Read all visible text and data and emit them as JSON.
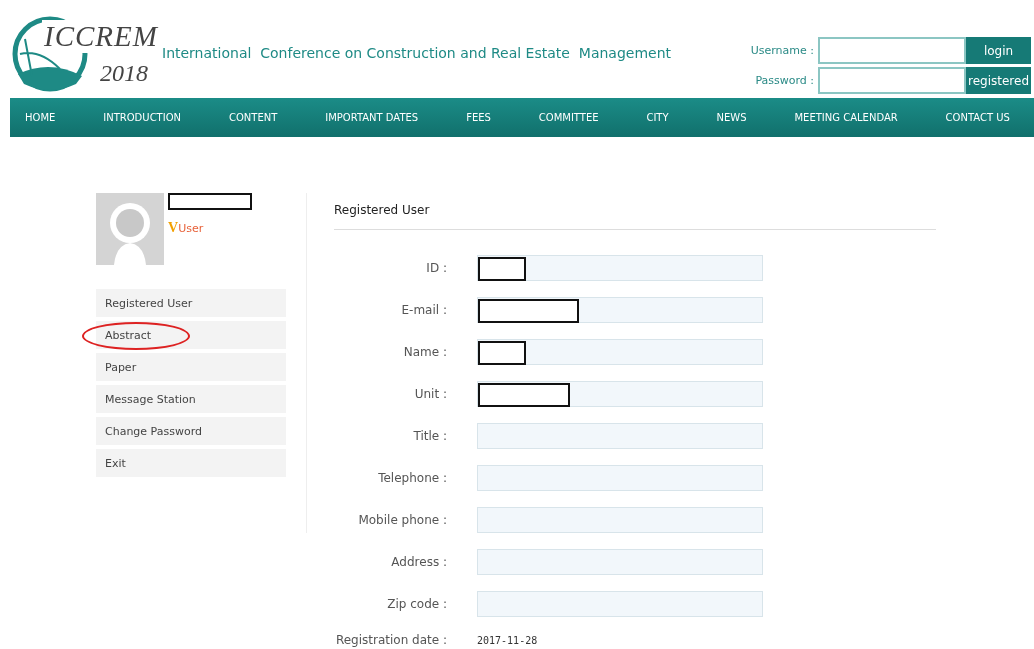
{
  "header": {
    "logo_title": "ICCREM",
    "logo_year": "2018",
    "conference": "International  Conference on Construction and Real Estate  Management"
  },
  "login": {
    "username_label": "Username :",
    "password_label": "Password :",
    "login_button": "login",
    "register_button": "registered"
  },
  "nav": [
    {
      "label": "HOME"
    },
    {
      "label": "INTRODUCTION"
    },
    {
      "label": "CONTENT"
    },
    {
      "label": "IMPORTANT DATES"
    },
    {
      "label": "FEES"
    },
    {
      "label": "COMMITTEE"
    },
    {
      "label": "CITY"
    },
    {
      "label": "NEWS"
    },
    {
      "label": "MEETING CALENDAR"
    },
    {
      "label": "CONTACT US"
    }
  ],
  "profile": {
    "name_redacted": true,
    "badge": "V",
    "role": "User"
  },
  "sidebar": {
    "items": [
      {
        "label": "Registered User",
        "circled": false
      },
      {
        "label": "Abstract",
        "circled": true
      },
      {
        "label": "Paper",
        "circled": false
      },
      {
        "label": "Message Station",
        "circled": false
      },
      {
        "label": "Change Password",
        "circled": false
      },
      {
        "label": "Exit",
        "circled": false
      }
    ]
  },
  "panel": {
    "title": "Registered User",
    "fields": [
      {
        "label": "ID :",
        "redacted": true
      },
      {
        "label": "E-mail :",
        "redacted": true
      },
      {
        "label": "Name :",
        "redacted": true
      },
      {
        "label": "Unit :",
        "redacted": true
      },
      {
        "label": "Title :",
        "redacted": false
      },
      {
        "label": "Telephone :",
        "redacted": false
      },
      {
        "label": "Mobile phone :",
        "redacted": false
      },
      {
        "label": "Address :",
        "redacted": false
      },
      {
        "label": "Zip code :",
        "redacted": false
      }
    ],
    "registration_label": "Registration date :",
    "registration_date": "2017-11-28"
  }
}
